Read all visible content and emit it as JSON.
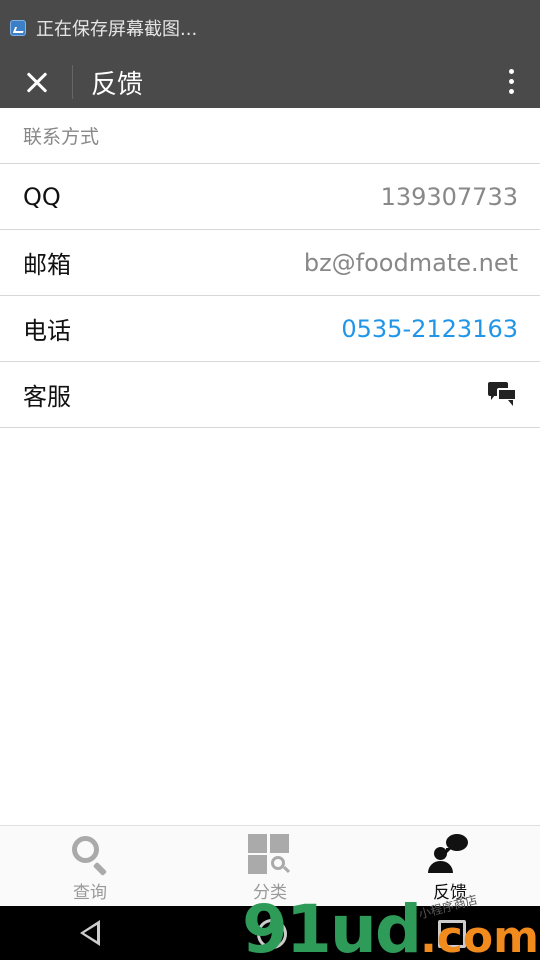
{
  "status_bar": {
    "notification_text": "正在保存屏幕截图..."
  },
  "title_bar": {
    "title": "反馈"
  },
  "section": {
    "header": "联系方式"
  },
  "contacts": [
    {
      "label": "QQ",
      "value": "139307733",
      "type": "text"
    },
    {
      "label": "邮箱",
      "value": "bz@foodmate.net",
      "type": "text"
    },
    {
      "label": "电话",
      "value": "0535-2123163",
      "type": "link"
    },
    {
      "label": "客服",
      "value": "",
      "type": "chat-icon"
    }
  ],
  "tabs": [
    {
      "label": "查询",
      "icon": "search-icon",
      "active": false
    },
    {
      "label": "分类",
      "icon": "category-icon",
      "active": false
    },
    {
      "label": "反馈",
      "icon": "feedback-icon",
      "active": true
    }
  ],
  "watermark": {
    "logo": "91ud",
    "suffix": ".com",
    "tagline": "小程序商店"
  },
  "colors": {
    "header_bg": "#4a4a4a",
    "link": "#2196e9",
    "muted_text": "#888888",
    "divider": "#d8d8d8",
    "tab_inactive": "#aaaaaa"
  }
}
